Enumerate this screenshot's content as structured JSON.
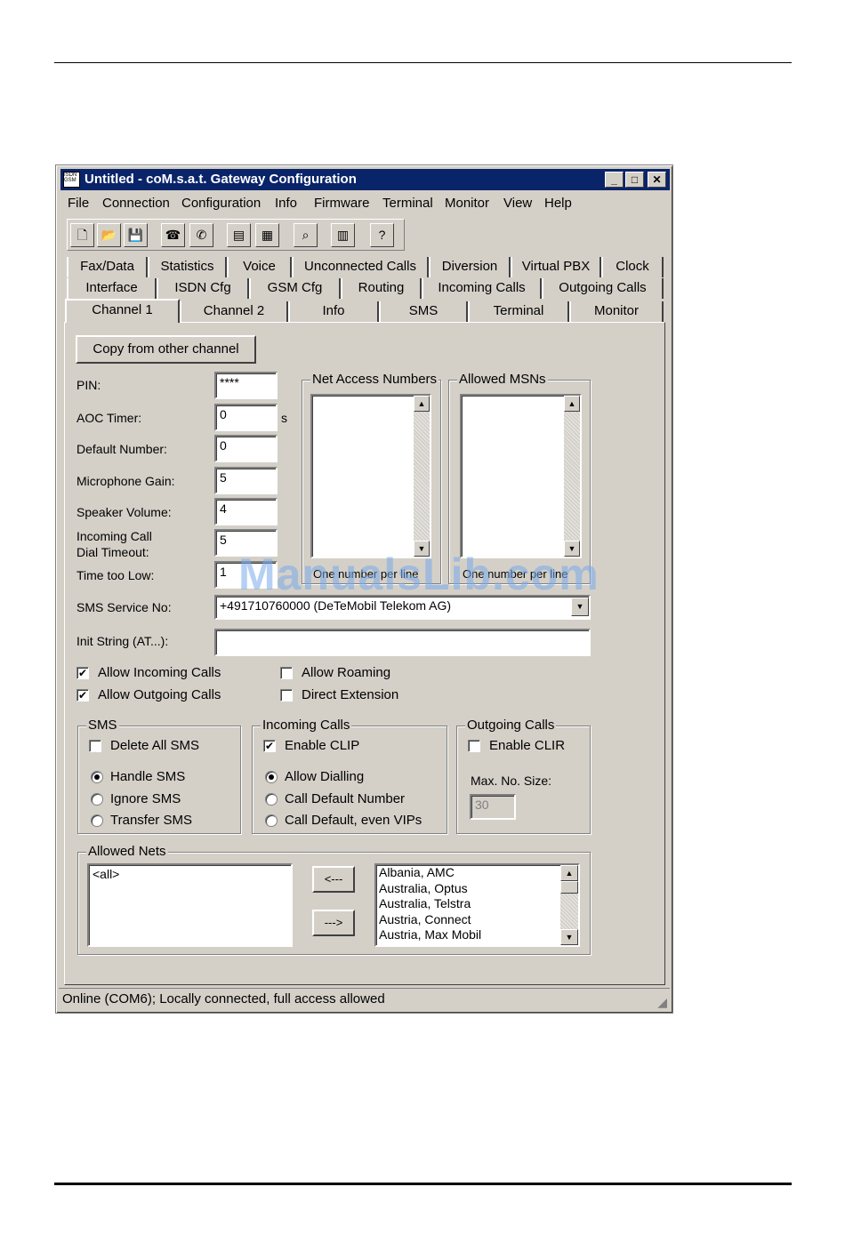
{
  "window": {
    "title": "Untitled - coM.s.a.t. Gateway Configuration",
    "icon_text": "ISDN GSM"
  },
  "menu": [
    "File",
    "Connection",
    "Configuration",
    "Info",
    "Firmware",
    "Terminal",
    "Monitor",
    "View",
    "Help"
  ],
  "toolbar": [
    "new-icon",
    "open-icon",
    "save-icon",
    "connect-icon",
    "disconnect-icon",
    "read-config-icon",
    "write-config-icon",
    "search-icon",
    "statistics-icon",
    "help-icon"
  ],
  "tabs": {
    "row1": [
      "Fax/Data",
      "Statistics",
      "Voice",
      "Unconnected Calls",
      "Diversion",
      "Virtual PBX",
      "Clock"
    ],
    "row2": [
      "Interface",
      "ISDN Cfg",
      "GSM Cfg",
      "Routing",
      "Incoming Calls",
      "Outgoing Calls"
    ],
    "row3": [
      "Channel 1",
      "Channel 2",
      "Info",
      "SMS",
      "Terminal",
      "Monitor"
    ]
  },
  "channel": {
    "copy_button": "Copy from other channel",
    "pin_label": "PIN:",
    "pin_value": "****",
    "aoc_label": "AOC Timer:",
    "aoc_value": "0",
    "aoc_unit": "s",
    "default_number_label": "Default Number:",
    "default_number_value": "0",
    "mic_label": "Microphone Gain:",
    "mic_value": "5",
    "speaker_label": "Speaker Volume:",
    "speaker_value": "4",
    "incoming_timeout_label_1": "Incoming Call",
    "incoming_timeout_label_2": "Dial Timeout:",
    "incoming_timeout_value": "5",
    "time_too_low_label": "Time too Low:",
    "time_too_low_value": "1",
    "net_access_title": "Net Access Numbers",
    "net_access_footer": "One number per line",
    "allowed_msns_title": "Allowed MSNs",
    "allowed_msns_footer": "One number per line",
    "sms_service_label": "SMS Service No:",
    "sms_service_value": "+491710760000 (DeTeMobil Telekom AG)",
    "init_label": "Init String (AT...):",
    "init_value": "",
    "allow_incoming": "Allow Incoming Calls",
    "allow_outgoing": "Allow Outgoing Calls",
    "allow_roaming": "Allow Roaming",
    "direct_extension": "Direct Extension"
  },
  "sms_group": {
    "title": "SMS",
    "delete_all": "Delete All SMS",
    "handle": "Handle SMS",
    "ignore": "Ignore SMS",
    "transfer": "Transfer SMS"
  },
  "incoming_group": {
    "title": "Incoming Calls",
    "enable_clip": "Enable CLIP",
    "allow_dialling": "Allow Dialling",
    "call_default": "Call Default Number",
    "call_default_vips": "Call Default, even VIPs"
  },
  "outgoing_group": {
    "title": "Outgoing Calls",
    "enable_clir": "Enable CLIR",
    "max_label": "Max. No. Size:",
    "max_value": "30"
  },
  "allowed_nets": {
    "title": "Allowed Nets",
    "selected": [
      "<all>"
    ],
    "left_btn": "<---",
    "right_btn": "--->",
    "available": [
      "Albania, AMC",
      "Australia, Optus",
      "Australia, Telstra",
      "Austria, Connect",
      "Austria, Max Mobil"
    ]
  },
  "status": "Online (COM6); Locally connected, full access allowed",
  "watermark": "ManualsLib.com"
}
